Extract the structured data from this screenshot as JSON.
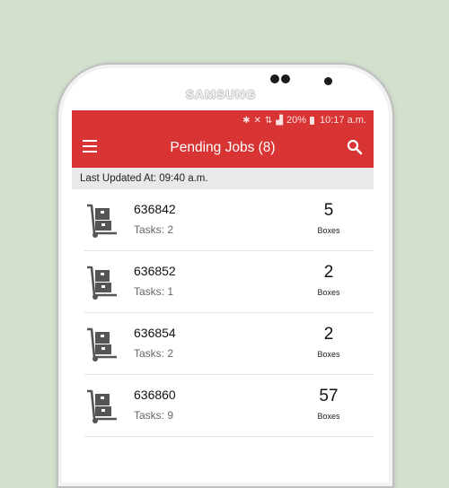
{
  "device": {
    "brand": "SAMSUNG"
  },
  "status_bar": {
    "battery": "20%",
    "time": "10:17 a.m."
  },
  "app_bar": {
    "title": "Pending Jobs (8)",
    "menu_icon": "menu-icon",
    "search_icon": "search-icon",
    "color": "#d93434"
  },
  "last_updated": "Last Updated At: 09:40 a.m.",
  "jobs": [
    {
      "id": "636842",
      "tasks": "Tasks: 2",
      "count": "5",
      "unit": "Boxes"
    },
    {
      "id": "636852",
      "tasks": "Tasks: 1",
      "count": "2",
      "unit": "Boxes"
    },
    {
      "id": "636854",
      "tasks": "Tasks: 2",
      "count": "2",
      "unit": "Boxes"
    },
    {
      "id": "636860",
      "tasks": "Tasks: 9",
      "count": "57",
      "unit": "Boxes"
    }
  ]
}
